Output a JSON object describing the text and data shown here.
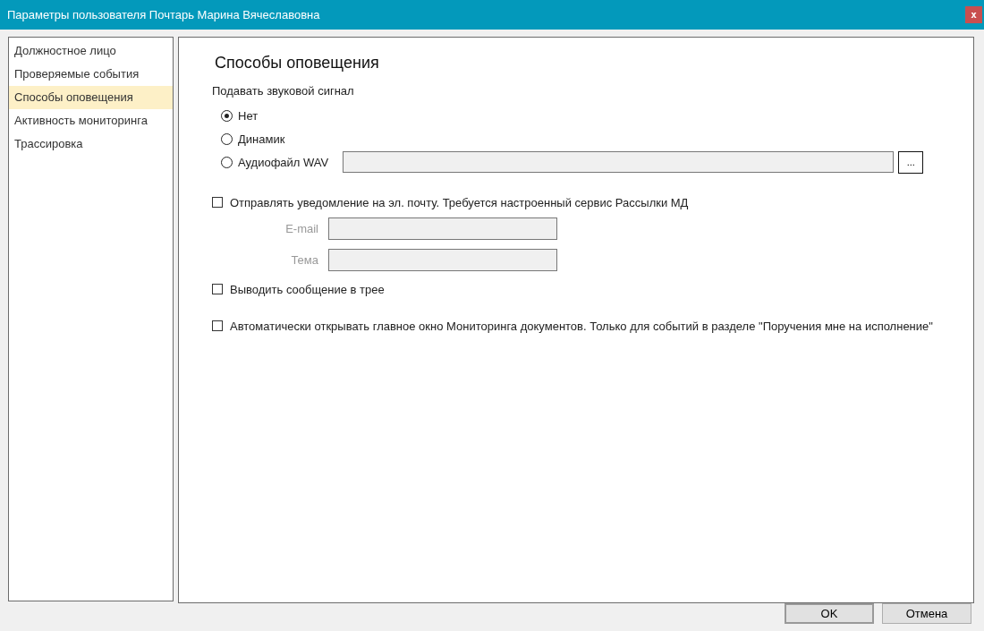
{
  "window": {
    "title": "Параметры пользователя Почтарь Марина Вячеславовна",
    "close": "x"
  },
  "sidebar": {
    "items": [
      {
        "label": "Должностное лицо",
        "selected": false
      },
      {
        "label": "Проверяемые события",
        "selected": false
      },
      {
        "label": "Способы оповещения",
        "selected": true
      },
      {
        "label": "Активность мониторинга",
        "selected": false
      },
      {
        "label": "Трассировка",
        "selected": false
      }
    ]
  },
  "panel": {
    "heading": "Способы оповещения",
    "sound_label": "Подавать звуковой сигнал",
    "sound_options": [
      {
        "label": "Нет",
        "selected": true
      },
      {
        "label": "Динамик",
        "selected": false
      },
      {
        "label": "Аудиофайл WAV",
        "selected": false
      }
    ],
    "browse_button": "...",
    "email": {
      "label": "Отправлять уведомление на эл. почту. Требуется настроенный сервис Рассылки МД",
      "checked": false,
      "fields": [
        {
          "label": "E-mail"
        },
        {
          "label": "Тема"
        }
      ]
    },
    "tray": {
      "label": "Выводить сообщение в трее",
      "checked": false
    },
    "auto_open": {
      "label": "Автоматически открывать главное окно Мониторинга документов. Только для событий в разделе \"Поручения мне на исполнение\"",
      "checked": false
    }
  },
  "buttons": [
    {
      "label": "OK",
      "default": true
    },
    {
      "label": "Отмена",
      "default": false
    }
  ]
}
